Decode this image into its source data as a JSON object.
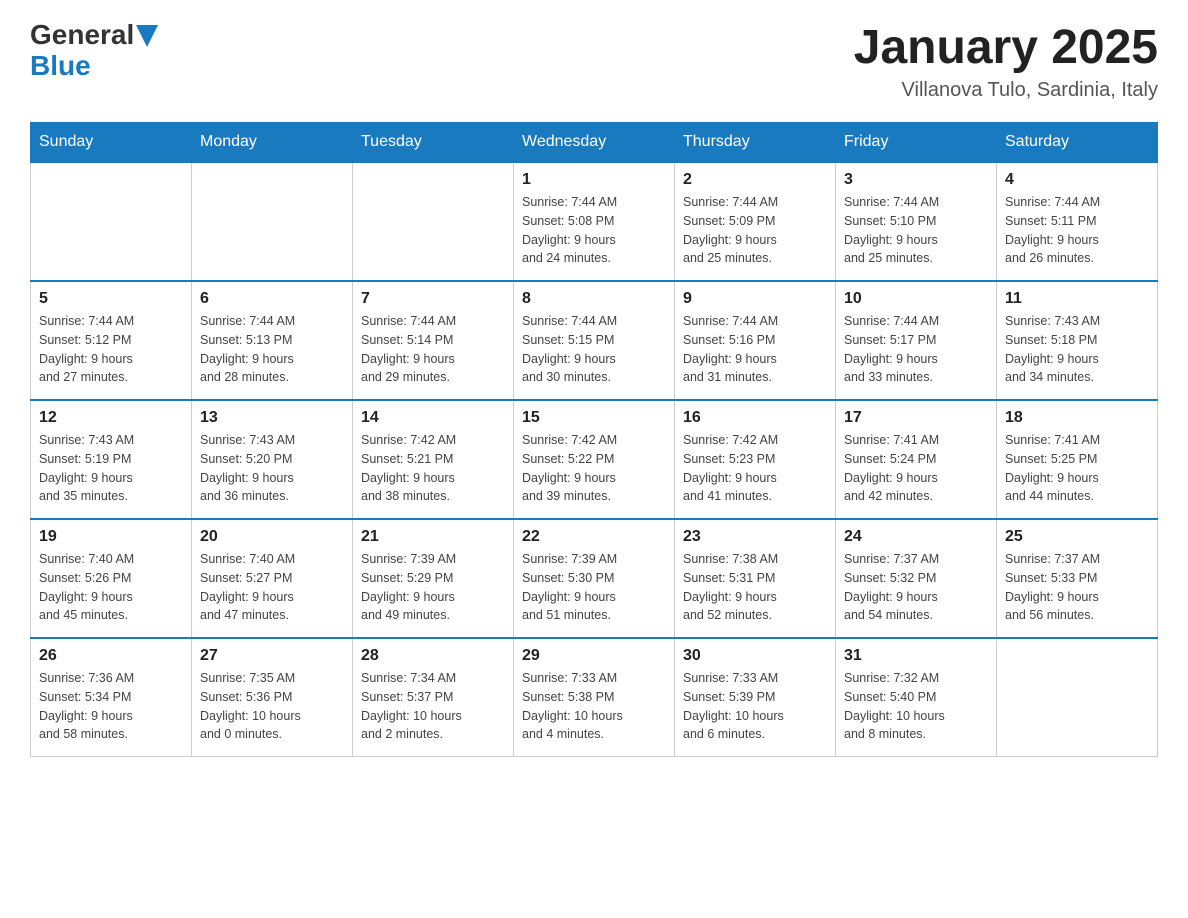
{
  "header": {
    "logo": {
      "general": "General",
      "blue": "Blue"
    },
    "title": "January 2025",
    "location": "Villanova Tulo, Sardinia, Italy"
  },
  "weekdays": [
    "Sunday",
    "Monday",
    "Tuesday",
    "Wednesday",
    "Thursday",
    "Friday",
    "Saturday"
  ],
  "weeks": [
    [
      {
        "day": "",
        "info": ""
      },
      {
        "day": "",
        "info": ""
      },
      {
        "day": "",
        "info": ""
      },
      {
        "day": "1",
        "info": "Sunrise: 7:44 AM\nSunset: 5:08 PM\nDaylight: 9 hours\nand 24 minutes."
      },
      {
        "day": "2",
        "info": "Sunrise: 7:44 AM\nSunset: 5:09 PM\nDaylight: 9 hours\nand 25 minutes."
      },
      {
        "day": "3",
        "info": "Sunrise: 7:44 AM\nSunset: 5:10 PM\nDaylight: 9 hours\nand 25 minutes."
      },
      {
        "day": "4",
        "info": "Sunrise: 7:44 AM\nSunset: 5:11 PM\nDaylight: 9 hours\nand 26 minutes."
      }
    ],
    [
      {
        "day": "5",
        "info": "Sunrise: 7:44 AM\nSunset: 5:12 PM\nDaylight: 9 hours\nand 27 minutes."
      },
      {
        "day": "6",
        "info": "Sunrise: 7:44 AM\nSunset: 5:13 PM\nDaylight: 9 hours\nand 28 minutes."
      },
      {
        "day": "7",
        "info": "Sunrise: 7:44 AM\nSunset: 5:14 PM\nDaylight: 9 hours\nand 29 minutes."
      },
      {
        "day": "8",
        "info": "Sunrise: 7:44 AM\nSunset: 5:15 PM\nDaylight: 9 hours\nand 30 minutes."
      },
      {
        "day": "9",
        "info": "Sunrise: 7:44 AM\nSunset: 5:16 PM\nDaylight: 9 hours\nand 31 minutes."
      },
      {
        "day": "10",
        "info": "Sunrise: 7:44 AM\nSunset: 5:17 PM\nDaylight: 9 hours\nand 33 minutes."
      },
      {
        "day": "11",
        "info": "Sunrise: 7:43 AM\nSunset: 5:18 PM\nDaylight: 9 hours\nand 34 minutes."
      }
    ],
    [
      {
        "day": "12",
        "info": "Sunrise: 7:43 AM\nSunset: 5:19 PM\nDaylight: 9 hours\nand 35 minutes."
      },
      {
        "day": "13",
        "info": "Sunrise: 7:43 AM\nSunset: 5:20 PM\nDaylight: 9 hours\nand 36 minutes."
      },
      {
        "day": "14",
        "info": "Sunrise: 7:42 AM\nSunset: 5:21 PM\nDaylight: 9 hours\nand 38 minutes."
      },
      {
        "day": "15",
        "info": "Sunrise: 7:42 AM\nSunset: 5:22 PM\nDaylight: 9 hours\nand 39 minutes."
      },
      {
        "day": "16",
        "info": "Sunrise: 7:42 AM\nSunset: 5:23 PM\nDaylight: 9 hours\nand 41 minutes."
      },
      {
        "day": "17",
        "info": "Sunrise: 7:41 AM\nSunset: 5:24 PM\nDaylight: 9 hours\nand 42 minutes."
      },
      {
        "day": "18",
        "info": "Sunrise: 7:41 AM\nSunset: 5:25 PM\nDaylight: 9 hours\nand 44 minutes."
      }
    ],
    [
      {
        "day": "19",
        "info": "Sunrise: 7:40 AM\nSunset: 5:26 PM\nDaylight: 9 hours\nand 45 minutes."
      },
      {
        "day": "20",
        "info": "Sunrise: 7:40 AM\nSunset: 5:27 PM\nDaylight: 9 hours\nand 47 minutes."
      },
      {
        "day": "21",
        "info": "Sunrise: 7:39 AM\nSunset: 5:29 PM\nDaylight: 9 hours\nand 49 minutes."
      },
      {
        "day": "22",
        "info": "Sunrise: 7:39 AM\nSunset: 5:30 PM\nDaylight: 9 hours\nand 51 minutes."
      },
      {
        "day": "23",
        "info": "Sunrise: 7:38 AM\nSunset: 5:31 PM\nDaylight: 9 hours\nand 52 minutes."
      },
      {
        "day": "24",
        "info": "Sunrise: 7:37 AM\nSunset: 5:32 PM\nDaylight: 9 hours\nand 54 minutes."
      },
      {
        "day": "25",
        "info": "Sunrise: 7:37 AM\nSunset: 5:33 PM\nDaylight: 9 hours\nand 56 minutes."
      }
    ],
    [
      {
        "day": "26",
        "info": "Sunrise: 7:36 AM\nSunset: 5:34 PM\nDaylight: 9 hours\nand 58 minutes."
      },
      {
        "day": "27",
        "info": "Sunrise: 7:35 AM\nSunset: 5:36 PM\nDaylight: 10 hours\nand 0 minutes."
      },
      {
        "day": "28",
        "info": "Sunrise: 7:34 AM\nSunset: 5:37 PM\nDaylight: 10 hours\nand 2 minutes."
      },
      {
        "day": "29",
        "info": "Sunrise: 7:33 AM\nSunset: 5:38 PM\nDaylight: 10 hours\nand 4 minutes."
      },
      {
        "day": "30",
        "info": "Sunrise: 7:33 AM\nSunset: 5:39 PM\nDaylight: 10 hours\nand 6 minutes."
      },
      {
        "day": "31",
        "info": "Sunrise: 7:32 AM\nSunset: 5:40 PM\nDaylight: 10 hours\nand 8 minutes."
      },
      {
        "day": "",
        "info": ""
      }
    ]
  ]
}
